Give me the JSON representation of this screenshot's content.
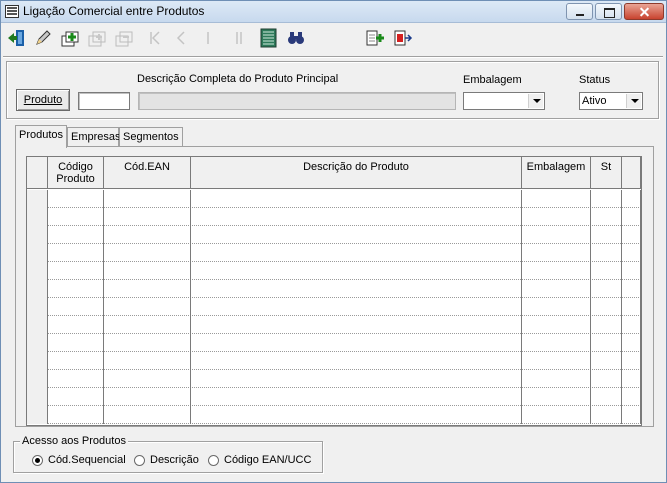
{
  "window": {
    "title": "Ligação Comercial entre Produtos"
  },
  "toolbar": {
    "buttons": [
      {
        "icon": "exit-door-icon",
        "enabled": true
      },
      {
        "icon": "pencil-edit-icon",
        "enabled": true
      },
      {
        "icon": "add-record-icon",
        "enabled": true
      },
      {
        "icon": "copy-record-icon",
        "enabled": false
      },
      {
        "icon": "remove-record-icon",
        "enabled": false
      },
      {
        "icon": "first-record-icon",
        "enabled": false
      },
      {
        "icon": "previous-record-icon",
        "enabled": false
      },
      {
        "icon": "next-record-icon",
        "enabled": false
      },
      {
        "icon": "last-record-icon",
        "enabled": false
      },
      {
        "icon": "list-grid-icon",
        "enabled": true
      },
      {
        "icon": "binoculars-search-icon",
        "enabled": true
      },
      {
        "icon": "insert-link-icon",
        "enabled": true
      },
      {
        "icon": "remove-link-icon",
        "enabled": true
      }
    ]
  },
  "header": {
    "produto_button": "Produto",
    "produto_code_value": "",
    "descricao_label": "Descrição Completa do Produto Principal",
    "descricao_value": "",
    "embalagem_label": "Embalagem",
    "embalagem_value": "",
    "status_label": "Status",
    "status_value": "Ativo"
  },
  "tabs": [
    {
      "label": "Produtos",
      "active": true
    },
    {
      "label": "Empresas",
      "active": false
    },
    {
      "label": "Segmentos",
      "active": false
    }
  ],
  "grid": {
    "columns": [
      {
        "label": "Código\nProduto"
      },
      {
        "label": "Cód.EAN"
      },
      {
        "label": "Descrição do Produto"
      },
      {
        "label": "Embalagem"
      },
      {
        "label": "St"
      }
    ],
    "rows": [
      [
        "",
        "",
        "",
        "",
        ""
      ],
      [
        "",
        "",
        "",
        "",
        ""
      ],
      [
        "",
        "",
        "",
        "",
        ""
      ],
      [
        "",
        "",
        "",
        "",
        ""
      ],
      [
        "",
        "",
        "",
        "",
        ""
      ],
      [
        "",
        "",
        "",
        "",
        ""
      ],
      [
        "",
        "",
        "",
        "",
        ""
      ],
      [
        "",
        "",
        "",
        "",
        ""
      ],
      [
        "",
        "",
        "",
        "",
        ""
      ],
      [
        "",
        "",
        "",
        "",
        ""
      ],
      [
        "",
        "",
        "",
        "",
        ""
      ],
      [
        "",
        "",
        "",
        "",
        ""
      ],
      [
        "",
        "",
        "",
        "",
        ""
      ]
    ]
  },
  "access": {
    "legend": "Acesso aos Produtos",
    "options": [
      {
        "label": "Cód.Sequencial",
        "selected": true
      },
      {
        "label": "Descrição",
        "selected": false
      },
      {
        "label": "Código EAN/UCC",
        "selected": false
      }
    ]
  }
}
